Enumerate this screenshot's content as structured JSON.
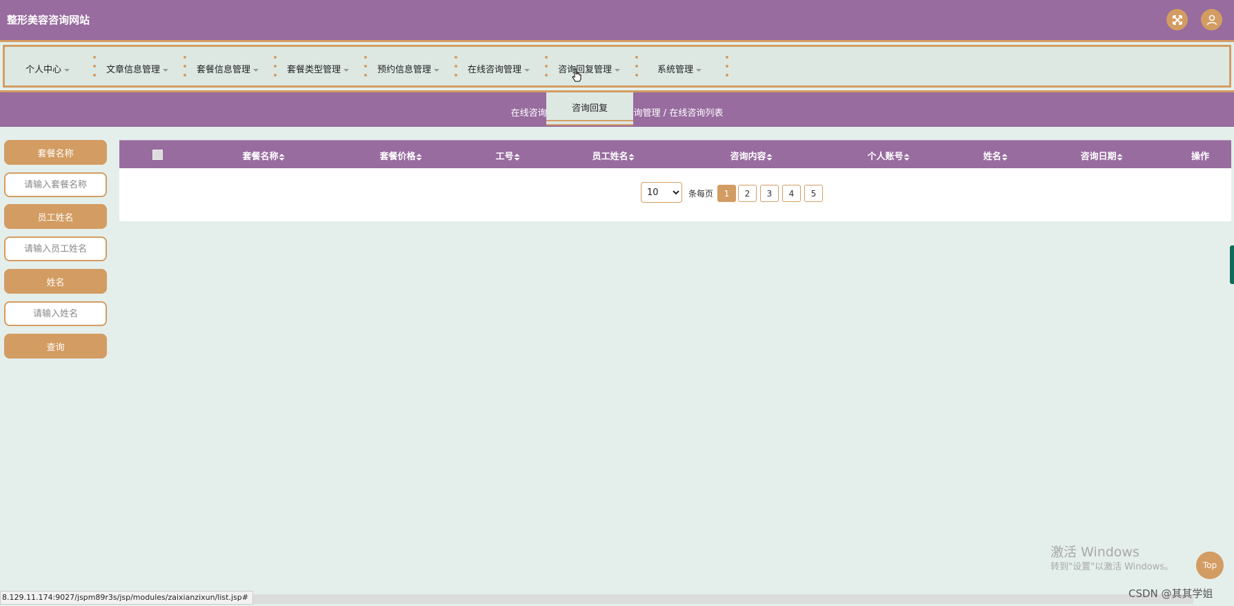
{
  "header": {
    "site_title": "整形美容咨询网站",
    "icons": [
      "fullscreen-icon",
      "user-icon"
    ]
  },
  "nav": {
    "items": [
      {
        "label": "个人中心"
      },
      {
        "label": "文章信息管理"
      },
      {
        "label": "套餐信息管理"
      },
      {
        "label": "套餐类型管理"
      },
      {
        "label": "预约信息管理"
      },
      {
        "label": "在线咨询管理"
      },
      {
        "label": "咨询回复管理"
      },
      {
        "label": "系统管理"
      }
    ],
    "open_dropdown": {
      "items": [
        {
          "label": "咨询回复"
        }
      ]
    }
  },
  "breadcrumb": {
    "left": "在线咨询",
    "right": "询管理 / 在线咨询列表"
  },
  "search": {
    "fields": [
      {
        "label": "套餐名称",
        "placeholder": "请输入套餐名称"
      },
      {
        "label": "员工姓名",
        "placeholder": "请输入员工姓名"
      },
      {
        "label": "姓名",
        "placeholder": "请输入姓名"
      }
    ],
    "button": "查询"
  },
  "table": {
    "columns": [
      "套餐名称",
      "套餐价格",
      "工号",
      "员工姓名",
      "咨询内容",
      "个人账号",
      "姓名",
      "咨询日期",
      "操作"
    ]
  },
  "pagination": {
    "page_size": "10",
    "per_page_label": "条每页",
    "pages": [
      "1",
      "2",
      "3",
      "4",
      "5"
    ],
    "current": "1"
  },
  "watermark": {
    "title": "激活 Windows",
    "subtitle": "转到\"设置\"以激活 Windows。"
  },
  "top_button": "Top",
  "status_url": "8.129.11.174:9027/jspm89r3s/jsp/modules/zaixianzixun/list.jsp#",
  "csdn_label": "CSDN @其其学姐",
  "colors": {
    "purple": "#986c9f",
    "orange": "#d39c62",
    "background": "#e4efeb"
  }
}
